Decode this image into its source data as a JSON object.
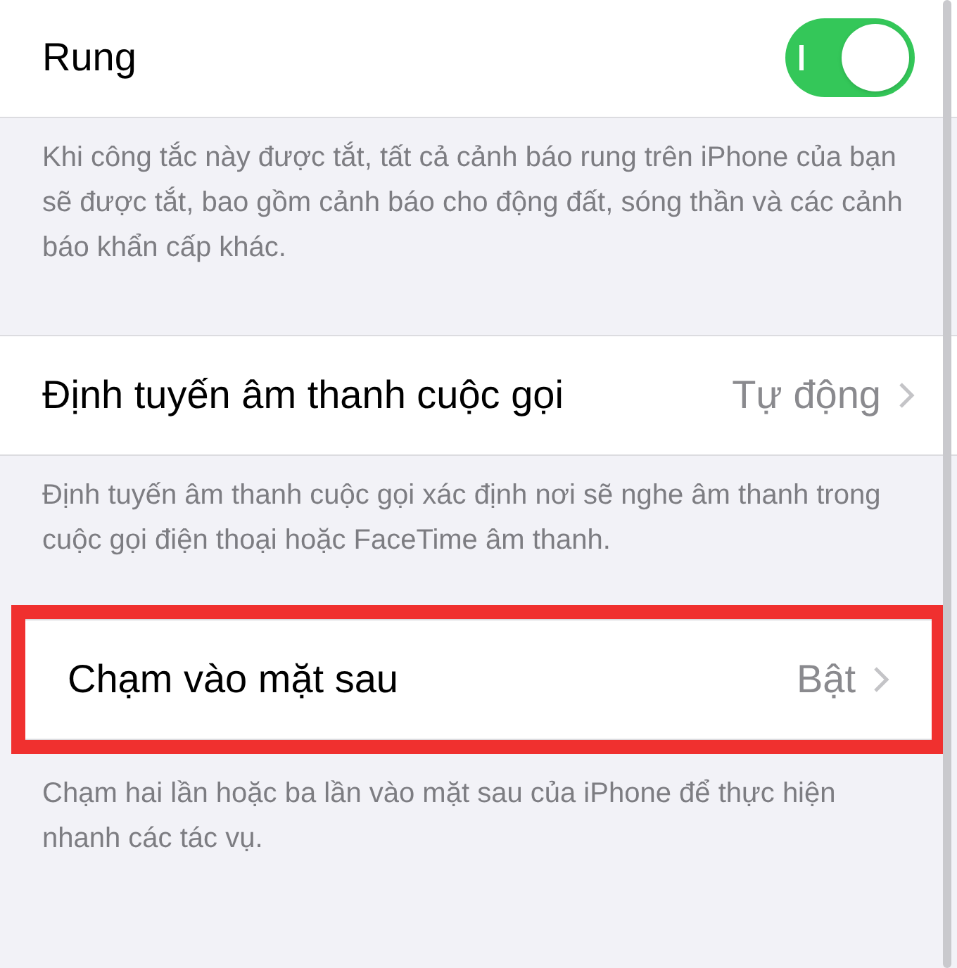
{
  "sections": [
    {
      "row": {
        "kind": "toggle",
        "label": "Rung",
        "on": true,
        "highlighted": false
      },
      "footer": "Khi công tắc này được tắt, tất cả cảnh báo rung trên iPhone của bạn sẽ được tắt, bao gồm cảnh báo cho động đất, sóng thần và các cảnh báo khẩn cấp khác."
    },
    {
      "row": {
        "kind": "link",
        "label": "Định tuyến âm thanh cuộc gọi",
        "value": "Tự động",
        "highlighted": false
      },
      "footer": "Định tuyến âm thanh cuộc gọi xác định nơi sẽ nghe âm thanh trong cuộc gọi điện thoại hoặc FaceTime âm thanh."
    },
    {
      "row": {
        "kind": "link",
        "label": "Chạm vào mặt sau",
        "value": "Bật",
        "highlighted": true
      },
      "footer": "Chạm hai lần hoặc ba lần vào mặt sau của iPhone để thực hiện nhanh các tác vụ."
    }
  ]
}
